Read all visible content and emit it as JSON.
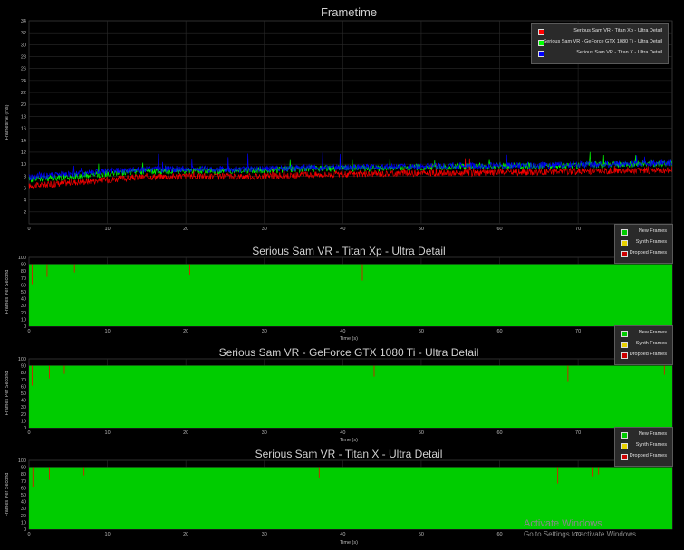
{
  "frametime_chart": {
    "title": "Frametime",
    "ylabel": "Frametime (ms)",
    "xlabel": "",
    "xlim": [
      0,
      82
    ],
    "ylim": [
      0,
      34
    ],
    "xticks": [
      0,
      10,
      20,
      30,
      40,
      50,
      60,
      70
    ],
    "yticks": [
      2,
      4,
      6,
      8,
      10,
      12,
      14,
      16,
      18,
      20,
      22,
      24,
      26,
      28,
      30,
      32,
      34
    ],
    "grid": true,
    "legend_position": "top-right",
    "legend": [
      {
        "label": "Serious Sam VR - Titan Xp - Ultra Detail",
        "color": "#ff0000"
      },
      {
        "label": "Serious Sam VR - GeForce GTX 1080 Ti - Ultra Detail",
        "color": "#00ff00"
      },
      {
        "label": "Serious Sam VR - Titan X - Ultra Detail",
        "color": "#0000ff"
      }
    ]
  },
  "frame_legend": [
    {
      "label": "New Frames",
      "color": "#00cc00"
    },
    {
      "label": "Synth Frames",
      "color": "#e8d000"
    },
    {
      "label": "Dropped Frames",
      "color": "#cc0000"
    }
  ],
  "panels": [
    {
      "title": "Serious Sam VR - Titan Xp - Ultra Detail",
      "ylabel": "Frames Per Second",
      "xlabel": "Time (s)"
    },
    {
      "title": "Serious Sam VR - GeForce GTX 1080 Ti - Ultra Detail",
      "ylabel": "Frames Per Second",
      "xlabel": "Time (s)"
    },
    {
      "title": "Serious Sam VR - Titan X - Ultra Detail",
      "ylabel": "Frames Per Second",
      "xlabel": "Time (s)"
    }
  ],
  "watermark": {
    "title": "Activate Windows",
    "subtitle": "Go to Settings to activate Windows."
  },
  "chart_data": [
    {
      "type": "line",
      "title": "Frametime",
      "ylabel": "Frametime (ms)",
      "xlim": [
        0,
        82
      ],
      "ylim": [
        0,
        34
      ],
      "series": [
        {
          "name": "Serious Sam VR - Titan Xp - Ultra Detail",
          "color": "#ff0000",
          "x": [
            0,
            5,
            10,
            15,
            20,
            25,
            30,
            35,
            40,
            45,
            50,
            55,
            60,
            65,
            70,
            75,
            82
          ],
          "y": [
            6.3,
            6.9,
            7.4,
            7.9,
            8.0,
            7.9,
            8.0,
            8.2,
            8.3,
            8.4,
            8.5,
            8.5,
            8.6,
            8.7,
            8.8,
            8.9,
            9.0
          ]
        },
        {
          "name": "Serious Sam VR - GeForce GTX 1080 Ti - Ultra Detail",
          "color": "#00ff00",
          "x": [
            0,
            5,
            10,
            15,
            20,
            25,
            30,
            35,
            40,
            45,
            50,
            55,
            60,
            65,
            70,
            75,
            82
          ],
          "y": [
            7.4,
            7.9,
            8.4,
            8.8,
            8.9,
            8.9,
            9.0,
            9.2,
            9.3,
            9.3,
            9.5,
            9.6,
            9.7,
            9.7,
            9.8,
            9.9,
            10.2
          ]
        },
        {
          "name": "Serious Sam VR - Titan X - Ultra Detail",
          "color": "#0000ff",
          "x": [
            0,
            5,
            10,
            15,
            20,
            25,
            30,
            35,
            40,
            45,
            50,
            55,
            60,
            65,
            70,
            75,
            82
          ],
          "y": [
            7.8,
            8.3,
            8.8,
            9.1,
            9.2,
            9.1,
            9.2,
            9.4,
            9.4,
            9.5,
            9.6,
            9.7,
            9.7,
            9.8,
            9.9,
            10.0,
            10.2
          ]
        }
      ]
    },
    {
      "type": "area",
      "title": "Serious Sam VR - Titan Xp - Ultra Detail",
      "ylabel": "Frames Per Second",
      "xlabel": "Time (s)",
      "xlim": [
        0,
        82
      ],
      "ylim": [
        0,
        100
      ],
      "xticks": [
        0,
        10,
        20,
        30,
        40,
        50,
        60,
        70
      ],
      "yticks": [
        0,
        10,
        20,
        30,
        40,
        50,
        60,
        70,
        80,
        90,
        100
      ],
      "new_frames_fps": 90,
      "end_time": 82,
      "dropped_frames_at": [
        0.4,
        2.3,
        5.8,
        20.5,
        42.5
      ]
    },
    {
      "type": "area",
      "title": "Serious Sam VR - GeForce GTX 1080 Ti - Ultra Detail",
      "ylabel": "Frames Per Second",
      "xlabel": "Time (s)",
      "xlim": [
        0,
        82
      ],
      "ylim": [
        0,
        100
      ],
      "xticks": [
        0,
        10,
        20,
        30,
        40,
        50,
        60,
        70
      ],
      "yticks": [
        0,
        10,
        20,
        30,
        40,
        50,
        60,
        70,
        80,
        90,
        100
      ],
      "new_frames_fps": 90,
      "end_time": 82,
      "dropped_frames_at": [
        0.4,
        2.6,
        4.5,
        44.0,
        68.7,
        81.0
      ]
    },
    {
      "type": "area",
      "title": "Serious Sam VR - Titan X - Ultra Detail",
      "ylabel": "Frames Per Second",
      "xlabel": "Time (s)",
      "xlim": [
        0,
        82
      ],
      "ylim": [
        0,
        100
      ],
      "xticks": [
        0,
        10,
        20,
        30,
        40,
        50,
        60,
        70
      ],
      "yticks": [
        0,
        10,
        20,
        30,
        40,
        50,
        60,
        70,
        80,
        90,
        100
      ],
      "new_frames_fps": 90,
      "end_time": 82,
      "dropped_frames_at": [
        0.5,
        2.6,
        7.0,
        37.0,
        67.4,
        71.9,
        72.6
      ]
    }
  ]
}
